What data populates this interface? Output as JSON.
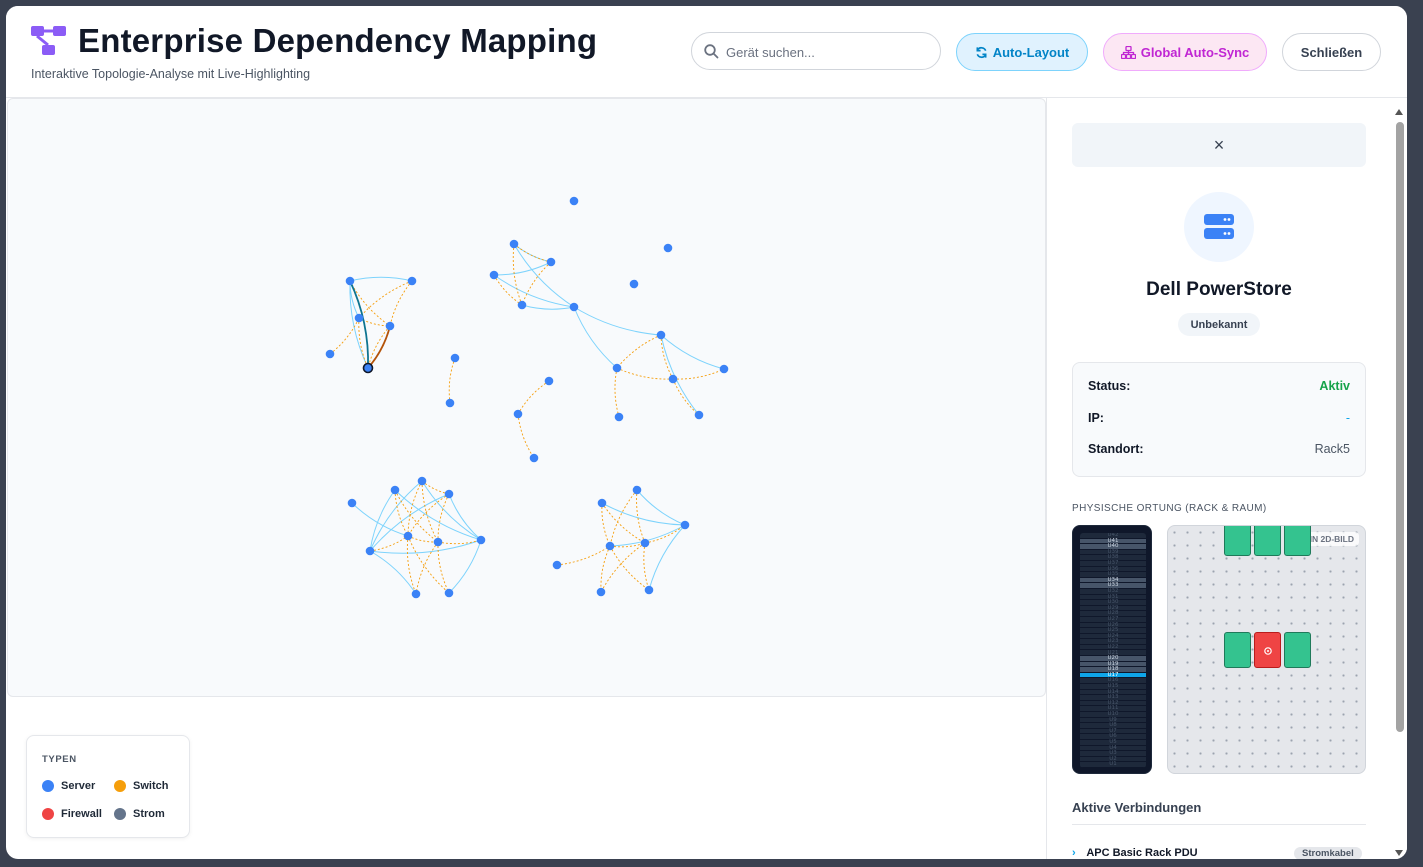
{
  "header": {
    "title": "Enterprise Dependency Mapping",
    "subtitle": "Interaktive Topologie-Analyse mit Live-Highlighting",
    "search_placeholder": "Gerät suchen...",
    "auto_layout_label": "Auto-Layout",
    "global_sync_label": "Global Auto-Sync",
    "close_label": "Schließen"
  },
  "colors": {
    "server": "#3b82f6",
    "switch": "#f59e0b",
    "firewall": "#ef4444",
    "strom": "#64748b",
    "link_primary": "#7dd3fc",
    "link_dependency": "#f59e0b",
    "accent_purple": "#8b5cf6"
  },
  "legend": {
    "title": "TYPEN",
    "items": [
      {
        "label": "Server",
        "color": "#3b82f6"
      },
      {
        "label": "Switch",
        "color": "#f59e0b"
      },
      {
        "label": "Firewall",
        "color": "#ef4444"
      },
      {
        "label": "Strom",
        "color": "#64748b"
      }
    ]
  },
  "panel": {
    "close_icon": "×",
    "device_name": "Dell PowerStore",
    "device_icon": "server-icon",
    "badge": "Unbekannt",
    "info": [
      {
        "label": "Status:",
        "value": "Aktiv",
        "color": "#16a34a"
      },
      {
        "label": "IP:",
        "value": "-",
        "color": "#0ea5e9"
      },
      {
        "label": "Standort:",
        "value": "Rack5",
        "color": "#4b5563"
      }
    ],
    "location_section": "PHYSISCHE ORTUNG (RACK & RAUM)",
    "room_badge": "KEIN 2D-BILD",
    "rack_units_top_down": [
      "U42",
      "U41",
      "U40",
      "U39",
      "U38",
      "U37",
      "U36",
      "U35",
      "U34",
      "U33",
      "U32",
      "U31",
      "U30",
      "U29",
      "U28",
      "U27",
      "U26",
      "U25",
      "U24",
      "U23",
      "U22",
      "U21",
      "U20",
      "U19",
      "U18",
      "U17",
      "U16",
      "U15",
      "U14",
      "U13",
      "U12",
      "U11",
      "U10",
      "U9",
      "U8",
      "U7",
      "U6",
      "U5",
      "U4",
      "U3",
      "U2",
      "U1"
    ],
    "rack_occupied_units": [
      "U41",
      "U40",
      "U34",
      "U33",
      "U20",
      "U19",
      "U18"
    ],
    "rack_highlight_unit": "U17",
    "connections_title": "Aktive Verbindungen",
    "connections": [
      {
        "label": "APC Basic Rack PDU",
        "tag": "Stromkabel"
      }
    ]
  },
  "graph": {
    "selected_node": "Dell PowerStore"
  }
}
